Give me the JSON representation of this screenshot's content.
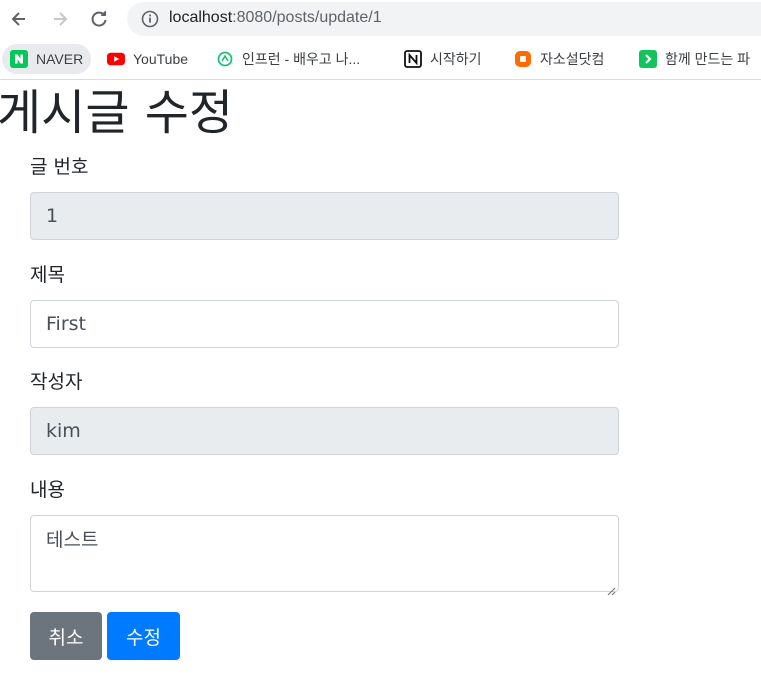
{
  "browser": {
    "url_host": "localhost",
    "url_path": ":8080/posts/update/1"
  },
  "bookmarks": [
    {
      "label": "NAVER",
      "icon": "naver-icon"
    },
    {
      "label": "YouTube",
      "icon": "youtube-icon"
    },
    {
      "label": "인프런 - 배우고 나...",
      "icon": "inflearn-icon"
    },
    {
      "label": "시작하기",
      "icon": "notion-icon"
    },
    {
      "label": "자소설닷컴",
      "icon": "jasoseol-icon"
    },
    {
      "label": "함께 만드는 파",
      "icon": "codeit-icon"
    }
  ],
  "page": {
    "title": "게시글 수정"
  },
  "form": {
    "id_label": "글 번호",
    "id_value": "1",
    "title_label": "제목",
    "title_value": "First",
    "author_label": "작성자",
    "author_value": "kim",
    "content_label": "내용",
    "content_value": "테스트"
  },
  "buttons": {
    "cancel": "취소",
    "submit": "수정"
  },
  "colors": {
    "cancel_bg": "#6c757d",
    "submit_bg": "#007bff",
    "readonly_bg": "#e9ecef"
  }
}
